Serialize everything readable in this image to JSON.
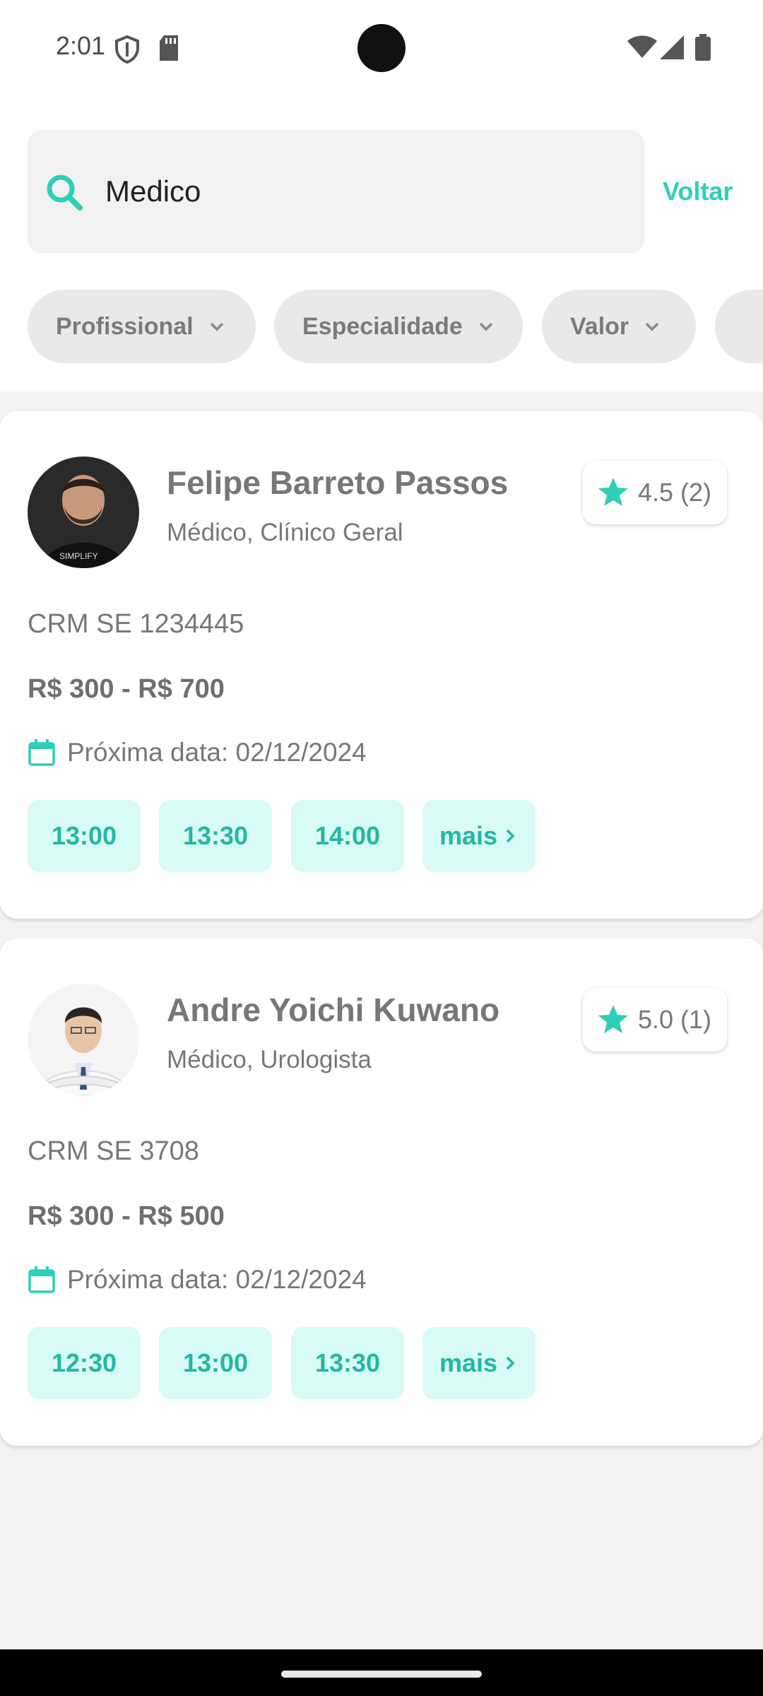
{
  "status_bar": {
    "time": "2:01",
    "icons": [
      "shield-icon",
      "sd-card-icon",
      "wifi-icon",
      "signal-icon",
      "battery-icon"
    ]
  },
  "search": {
    "value": "Medico",
    "placeholder": "",
    "back_label": "Voltar"
  },
  "filters": [
    {
      "label": "Profissional"
    },
    {
      "label": "Especialidade"
    },
    {
      "label": "Valor"
    }
  ],
  "doctors": [
    {
      "name": "Felipe Barreto Passos",
      "specialty": "Médico, Clínico Geral",
      "rating": "4.5 (2)",
      "crm": "CRM SE 1234445",
      "price": "R$ 300 - R$ 700",
      "next_date": "Próxima data: 02/12/2024",
      "slots": [
        "13:00",
        "13:30",
        "14:00"
      ],
      "more_label": "mais"
    },
    {
      "name": "Andre Yoichi Kuwano",
      "specialty": "Médico, Urologista",
      "rating": "5.0 (1)",
      "crm": "CRM SE 3708",
      "price": "R$ 300 - R$ 500",
      "next_date": "Próxima data: 02/12/2024",
      "slots": [
        "12:30",
        "13:00",
        "13:30"
      ],
      "more_label": "mais"
    }
  ],
  "colors": {
    "accent": "#2ecfb8",
    "slot_bg": "#d9fbf6",
    "slot_text": "#22b8a4",
    "star": "#2ecfb8"
  }
}
